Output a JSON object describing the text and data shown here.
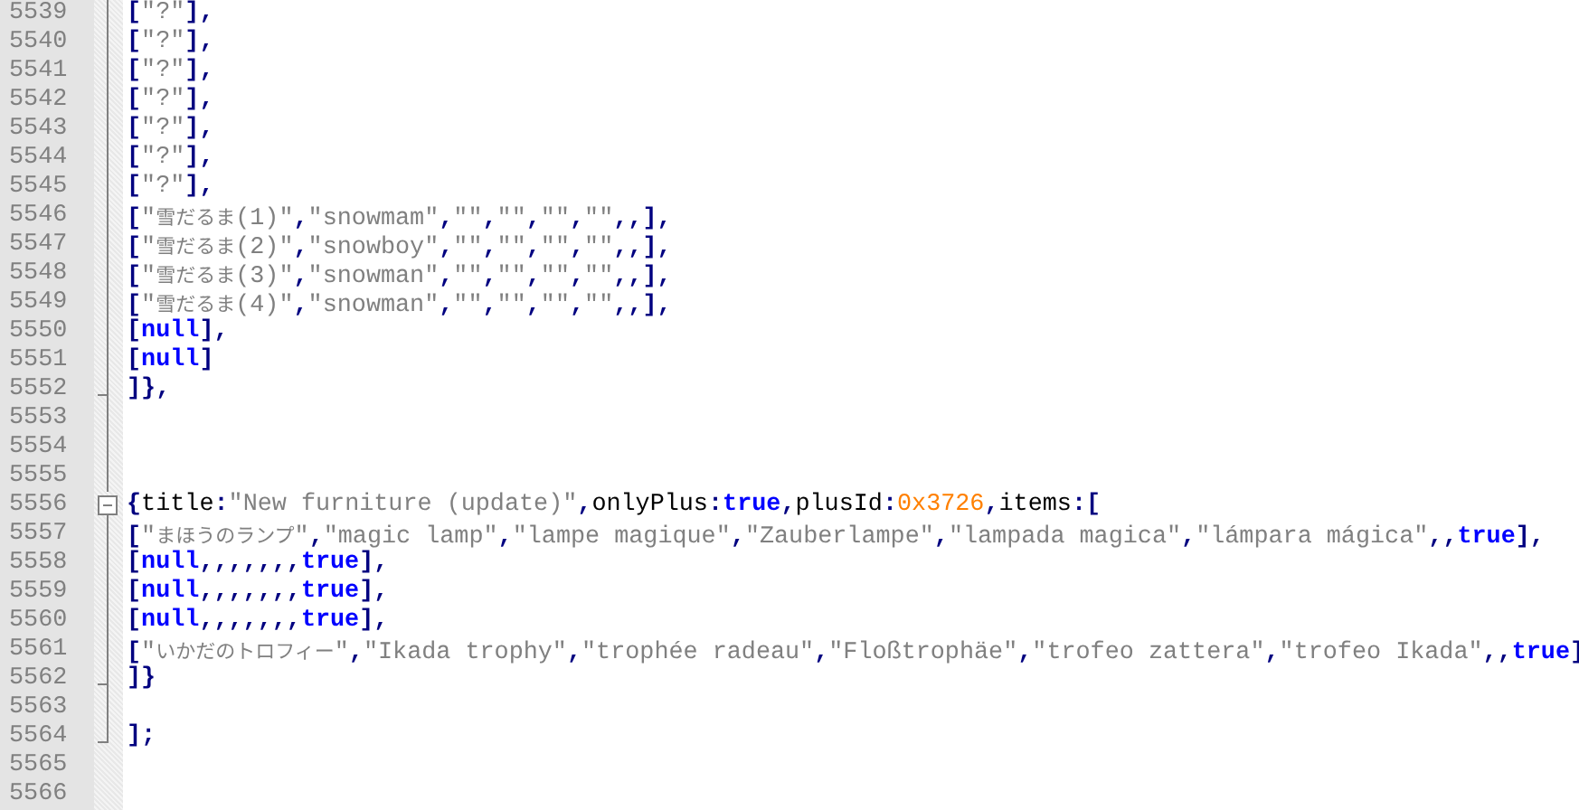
{
  "editor": {
    "lines": [
      {
        "number": "5539",
        "fold": {
          "kind": "bar"
        },
        "tokens": [
          {
            "text": "[",
            "kind": "op"
          },
          {
            "text": "\"?\"",
            "kind": "str"
          },
          {
            "text": "],",
            "kind": "op"
          }
        ]
      },
      {
        "number": "5540",
        "fold": {
          "kind": "bar"
        },
        "tokens": [
          {
            "text": "[",
            "kind": "op"
          },
          {
            "text": "\"?\"",
            "kind": "str"
          },
          {
            "text": "],",
            "kind": "op"
          }
        ]
      },
      {
        "number": "5541",
        "fold": {
          "kind": "bar"
        },
        "tokens": [
          {
            "text": "[",
            "kind": "op"
          },
          {
            "text": "\"?\"",
            "kind": "str"
          },
          {
            "text": "],",
            "kind": "op"
          }
        ]
      },
      {
        "number": "5542",
        "fold": {
          "kind": "bar"
        },
        "tokens": [
          {
            "text": "[",
            "kind": "op"
          },
          {
            "text": "\"?\"",
            "kind": "str"
          },
          {
            "text": "],",
            "kind": "op"
          }
        ]
      },
      {
        "number": "5543",
        "fold": {
          "kind": "bar"
        },
        "tokens": [
          {
            "text": "[",
            "kind": "op"
          },
          {
            "text": "\"?\"",
            "kind": "str"
          },
          {
            "text": "],",
            "kind": "op"
          }
        ]
      },
      {
        "number": "5544",
        "fold": {
          "kind": "bar"
        },
        "tokens": [
          {
            "text": "[",
            "kind": "op"
          },
          {
            "text": "\"?\"",
            "kind": "str"
          },
          {
            "text": "],",
            "kind": "op"
          }
        ]
      },
      {
        "number": "5545",
        "fold": {
          "kind": "bar"
        },
        "tokens": [
          {
            "text": "[",
            "kind": "op"
          },
          {
            "text": "\"?\"",
            "kind": "str"
          },
          {
            "text": "],",
            "kind": "op"
          }
        ]
      },
      {
        "number": "5546",
        "fold": {
          "kind": "bar"
        },
        "tokens": [
          {
            "text": "[",
            "kind": "op"
          },
          {
            "text": "\"",
            "kind": "str"
          },
          {
            "text": "雪だるま",
            "kind": "cjk"
          },
          {
            "text": "(1)\"",
            "kind": "str"
          },
          {
            "text": ",",
            "kind": "op"
          },
          {
            "text": "\"snowmam\"",
            "kind": "str"
          },
          {
            "text": ",",
            "kind": "op"
          },
          {
            "text": "\"\"",
            "kind": "str"
          },
          {
            "text": ",",
            "kind": "op"
          },
          {
            "text": "\"\"",
            "kind": "str"
          },
          {
            "text": ",",
            "kind": "op"
          },
          {
            "text": "\"\"",
            "kind": "str"
          },
          {
            "text": ",",
            "kind": "op"
          },
          {
            "text": "\"\"",
            "kind": "str"
          },
          {
            "text": ",,],",
            "kind": "op"
          }
        ]
      },
      {
        "number": "5547",
        "fold": {
          "kind": "bar"
        },
        "tokens": [
          {
            "text": "[",
            "kind": "op"
          },
          {
            "text": "\"",
            "kind": "str"
          },
          {
            "text": "雪だるま",
            "kind": "cjk"
          },
          {
            "text": "(2)\"",
            "kind": "str"
          },
          {
            "text": ",",
            "kind": "op"
          },
          {
            "text": "\"snowboy\"",
            "kind": "str"
          },
          {
            "text": ",",
            "kind": "op"
          },
          {
            "text": "\"\"",
            "kind": "str"
          },
          {
            "text": ",",
            "kind": "op"
          },
          {
            "text": "\"\"",
            "kind": "str"
          },
          {
            "text": ",",
            "kind": "op"
          },
          {
            "text": "\"\"",
            "kind": "str"
          },
          {
            "text": ",",
            "kind": "op"
          },
          {
            "text": "\"\"",
            "kind": "str"
          },
          {
            "text": ",,],",
            "kind": "op"
          }
        ]
      },
      {
        "number": "5548",
        "fold": {
          "kind": "bar"
        },
        "tokens": [
          {
            "text": "[",
            "kind": "op"
          },
          {
            "text": "\"",
            "kind": "str"
          },
          {
            "text": "雪だるま",
            "kind": "cjk"
          },
          {
            "text": "(3)\"",
            "kind": "str"
          },
          {
            "text": ",",
            "kind": "op"
          },
          {
            "text": "\"snowman\"",
            "kind": "str"
          },
          {
            "text": ",",
            "kind": "op"
          },
          {
            "text": "\"\"",
            "kind": "str"
          },
          {
            "text": ",",
            "kind": "op"
          },
          {
            "text": "\"\"",
            "kind": "str"
          },
          {
            "text": ",",
            "kind": "op"
          },
          {
            "text": "\"\"",
            "kind": "str"
          },
          {
            "text": ",",
            "kind": "op"
          },
          {
            "text": "\"\"",
            "kind": "str"
          },
          {
            "text": ",,],",
            "kind": "op"
          }
        ]
      },
      {
        "number": "5549",
        "fold": {
          "kind": "bar"
        },
        "tokens": [
          {
            "text": "[",
            "kind": "op"
          },
          {
            "text": "\"",
            "kind": "str"
          },
          {
            "text": "雪だるま",
            "kind": "cjk"
          },
          {
            "text": "(4)\"",
            "kind": "str"
          },
          {
            "text": ",",
            "kind": "op"
          },
          {
            "text": "\"snowman\"",
            "kind": "str"
          },
          {
            "text": ",",
            "kind": "op"
          },
          {
            "text": "\"\"",
            "kind": "str"
          },
          {
            "text": ",",
            "kind": "op"
          },
          {
            "text": "\"\"",
            "kind": "str"
          },
          {
            "text": ",",
            "kind": "op"
          },
          {
            "text": "\"\"",
            "kind": "str"
          },
          {
            "text": ",",
            "kind": "op"
          },
          {
            "text": "\"\"",
            "kind": "str"
          },
          {
            "text": ",,],",
            "kind": "op"
          }
        ]
      },
      {
        "number": "5550",
        "fold": {
          "kind": "bar"
        },
        "tokens": [
          {
            "text": "[",
            "kind": "op"
          },
          {
            "text": "null",
            "kind": "kw"
          },
          {
            "text": "],",
            "kind": "op"
          }
        ]
      },
      {
        "number": "5551",
        "fold": {
          "kind": "bar"
        },
        "tokens": [
          {
            "text": "[",
            "kind": "op"
          },
          {
            "text": "null",
            "kind": "kw"
          },
          {
            "text": "]",
            "kind": "op"
          }
        ]
      },
      {
        "number": "5552",
        "fold": {
          "kind": "end"
        },
        "tokens": [
          {
            "text": "]},",
            "kind": "op"
          }
        ]
      },
      {
        "number": "5553",
        "fold": {
          "kind": "bar"
        }
      },
      {
        "number": "5554",
        "fold": {
          "kind": "bar"
        }
      },
      {
        "number": "5555",
        "fold": {
          "kind": "bar"
        }
      },
      {
        "number": "5556",
        "fold": {
          "kind": "box"
        },
        "tokens": [
          {
            "text": "{",
            "kind": "op"
          },
          {
            "text": "title",
            "kind": "id"
          },
          {
            "text": ":",
            "kind": "op"
          },
          {
            "text": "\"New furniture (update)\"",
            "kind": "str"
          },
          {
            "text": ",",
            "kind": "op"
          },
          {
            "text": "onlyPlus",
            "kind": "id"
          },
          {
            "text": ":",
            "kind": "op"
          },
          {
            "text": "true",
            "kind": "kw"
          },
          {
            "text": ",",
            "kind": "op"
          },
          {
            "text": "plusId",
            "kind": "id"
          },
          {
            "text": ":",
            "kind": "op"
          },
          {
            "text": "0x3726",
            "kind": "num"
          },
          {
            "text": ",",
            "kind": "op"
          },
          {
            "text": "items",
            "kind": "id"
          },
          {
            "text": ":[",
            "kind": "op"
          }
        ]
      },
      {
        "number": "5557",
        "fold": {
          "kind": "bar"
        },
        "tokens": [
          {
            "text": "[",
            "kind": "op"
          },
          {
            "text": "\"",
            "kind": "str"
          },
          {
            "text": "まほうのランプ",
            "kind": "cjk"
          },
          {
            "text": "\"",
            "kind": "str"
          },
          {
            "text": ",",
            "kind": "op"
          },
          {
            "text": "\"magic lamp\"",
            "kind": "str"
          },
          {
            "text": ",",
            "kind": "op"
          },
          {
            "text": "\"lampe magique\"",
            "kind": "str"
          },
          {
            "text": ",",
            "kind": "op"
          },
          {
            "text": "\"Zauberlampe\"",
            "kind": "str"
          },
          {
            "text": ",",
            "kind": "op"
          },
          {
            "text": "\"lampada magica\"",
            "kind": "str"
          },
          {
            "text": ",",
            "kind": "op"
          },
          {
            "text": "\"lámpara mágica\"",
            "kind": "str"
          },
          {
            "text": ",,",
            "kind": "op"
          },
          {
            "text": "true",
            "kind": "kw"
          },
          {
            "text": "],",
            "kind": "op"
          }
        ]
      },
      {
        "number": "5558",
        "fold": {
          "kind": "bar"
        },
        "tokens": [
          {
            "text": "[",
            "kind": "op"
          },
          {
            "text": "null",
            "kind": "kw"
          },
          {
            "text": ",,,,,,,",
            "kind": "op"
          },
          {
            "text": "true",
            "kind": "kw"
          },
          {
            "text": "],",
            "kind": "op"
          }
        ]
      },
      {
        "number": "5559",
        "fold": {
          "kind": "bar"
        },
        "tokens": [
          {
            "text": "[",
            "kind": "op"
          },
          {
            "text": "null",
            "kind": "kw"
          },
          {
            "text": ",,,,,,,",
            "kind": "op"
          },
          {
            "text": "true",
            "kind": "kw"
          },
          {
            "text": "],",
            "kind": "op"
          }
        ]
      },
      {
        "number": "5560",
        "fold": {
          "kind": "bar"
        },
        "tokens": [
          {
            "text": "[",
            "kind": "op"
          },
          {
            "text": "null",
            "kind": "kw"
          },
          {
            "text": ",,,,,,,",
            "kind": "op"
          },
          {
            "text": "true",
            "kind": "kw"
          },
          {
            "text": "],",
            "kind": "op"
          }
        ]
      },
      {
        "number": "5561",
        "fold": {
          "kind": "bar"
        },
        "tokens": [
          {
            "text": "[",
            "kind": "op"
          },
          {
            "text": "\"",
            "kind": "str"
          },
          {
            "text": "いかだのトロフィー",
            "kind": "cjk"
          },
          {
            "text": "\"",
            "kind": "str"
          },
          {
            "text": ",",
            "kind": "op"
          },
          {
            "text": "\"Ikada trophy\"",
            "kind": "str"
          },
          {
            "text": ",",
            "kind": "op"
          },
          {
            "text": "\"trophée radeau\"",
            "kind": "str"
          },
          {
            "text": ",",
            "kind": "op"
          },
          {
            "text": "\"Floßtrophäe\"",
            "kind": "str"
          },
          {
            "text": ",",
            "kind": "op"
          },
          {
            "text": "\"trofeo zattera\"",
            "kind": "str"
          },
          {
            "text": ",",
            "kind": "op"
          },
          {
            "text": "\"trofeo Ikada\"",
            "kind": "str"
          },
          {
            "text": ",,",
            "kind": "op"
          },
          {
            "text": "true",
            "kind": "kw"
          },
          {
            "text": "]",
            "kind": "op"
          }
        ]
      },
      {
        "number": "5562",
        "fold": {
          "kind": "end"
        },
        "tokens": [
          {
            "text": "]}",
            "kind": "op"
          }
        ]
      },
      {
        "number": "5563",
        "fold": {
          "kind": "bar"
        }
      },
      {
        "number": "5564",
        "fold": {
          "kind": "last"
        },
        "tokens": [
          {
            "text": "];",
            "kind": "op"
          }
        ]
      },
      {
        "number": "5565"
      },
      {
        "number": "5566"
      }
    ]
  }
}
